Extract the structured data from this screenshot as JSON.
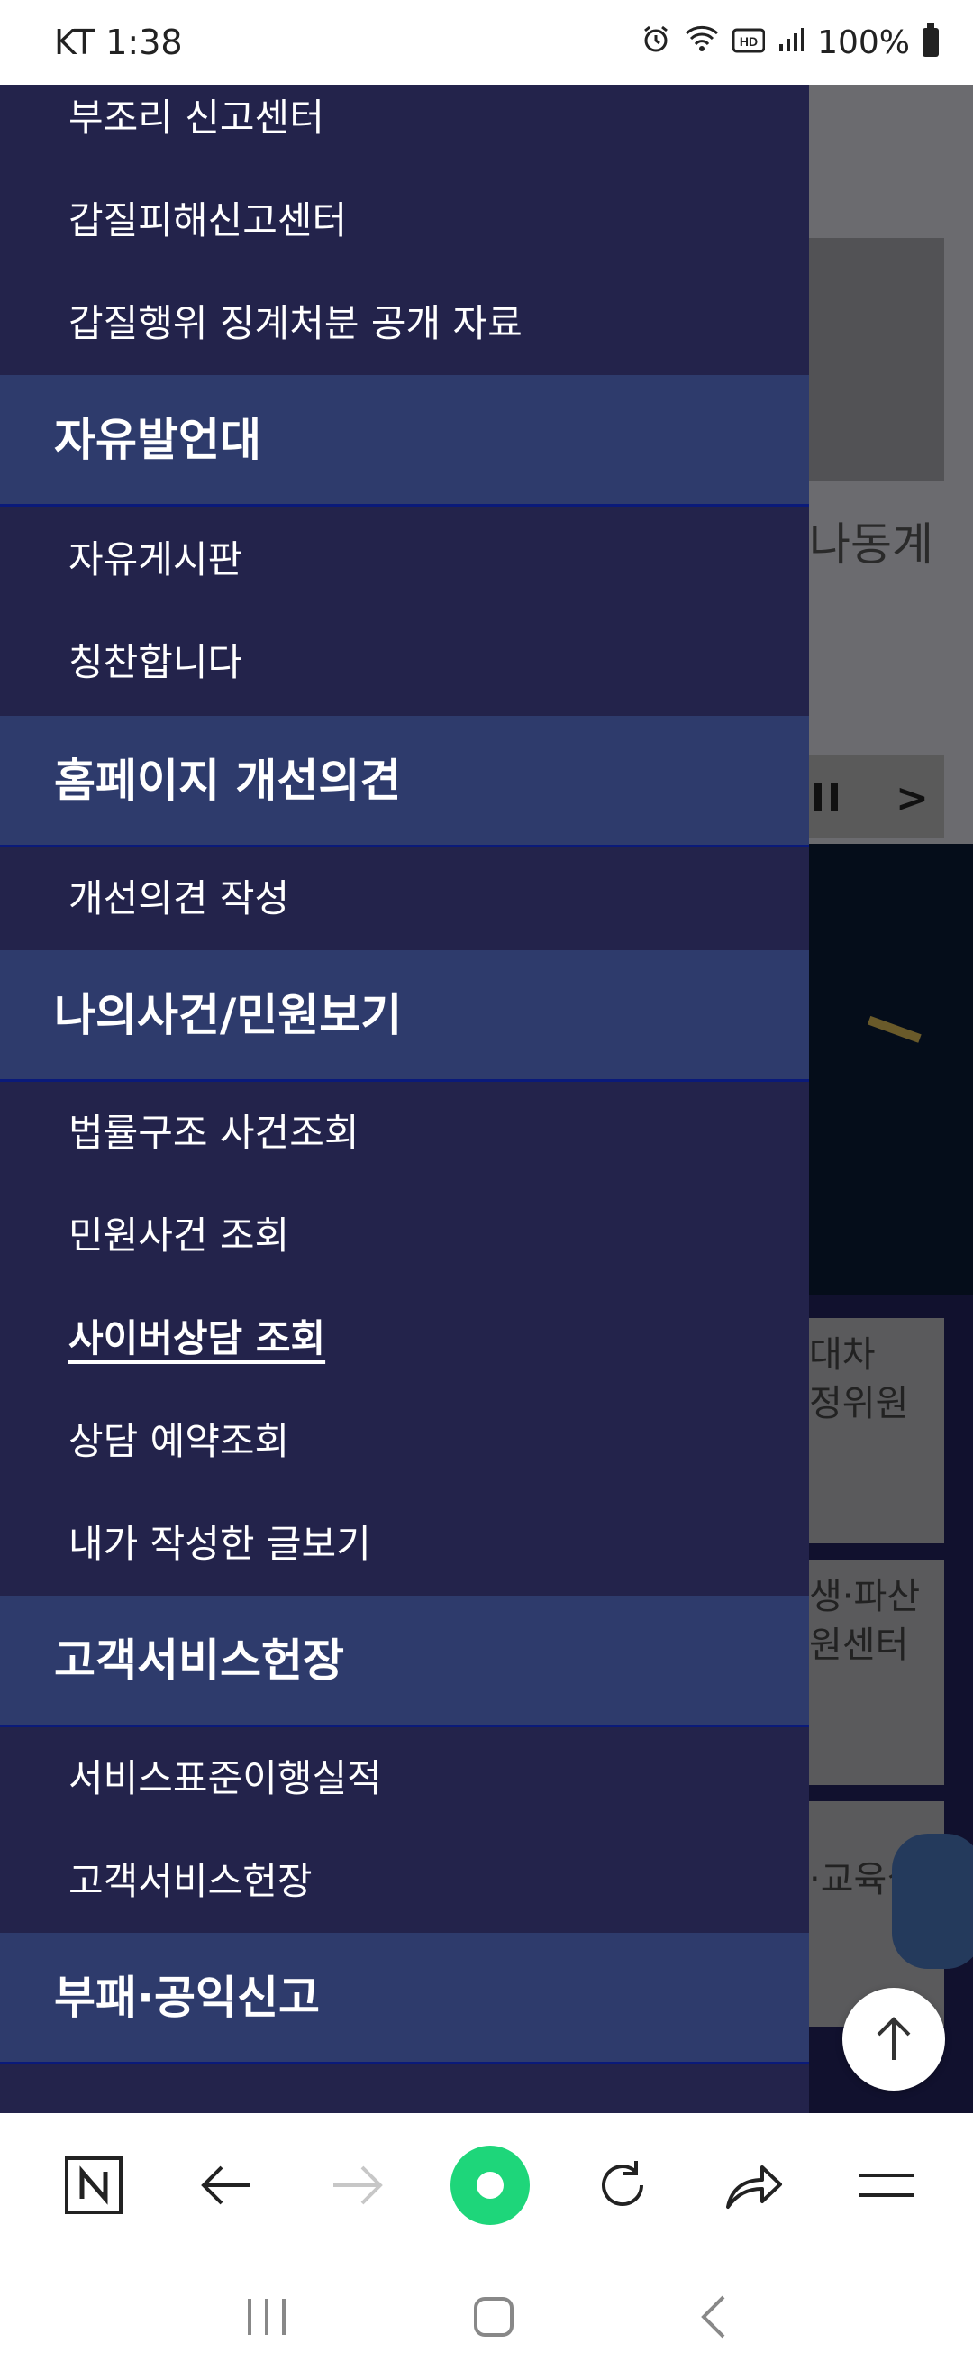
{
  "status_bar": {
    "carrier_time": "KT 1:38",
    "battery": "100%"
  },
  "drawer": {
    "groups": [
      {
        "category": null,
        "items": [
          "부조리 신고센터",
          "갑질피해신고센터",
          "갑질행위 징계처분 공개 자료"
        ]
      },
      {
        "category": "자유발언대",
        "items": [
          "자유게시판",
          "칭찬합니다"
        ]
      },
      {
        "category": "홈페이지 개선의견",
        "items": [
          "개선의견 작성"
        ]
      },
      {
        "category": "나의사건/민원보기",
        "items": [
          "법률구조 사건조회",
          "민원사건 조회",
          "사이버상담 조회",
          "상담 예약조회",
          "내가 작성한 글보기"
        ]
      },
      {
        "category": "고객서비스헌장",
        "items": [
          "서비스표준이행실적",
          "고객서비스헌장"
        ]
      },
      {
        "category": "부패·공익신고",
        "items": []
      }
    ]
  },
  "background_page": {
    "text1": "나동계",
    "card1": [
      "대차",
      "정위원"
    ],
    "card2": [
      "생·파산",
      "원센터"
    ],
    "card3": [
      "·교육실"
    ]
  },
  "colors": {
    "drawer_bg": "#23234b",
    "category_bg": "#2e3b6c",
    "accent_green": "#1ed67a"
  }
}
